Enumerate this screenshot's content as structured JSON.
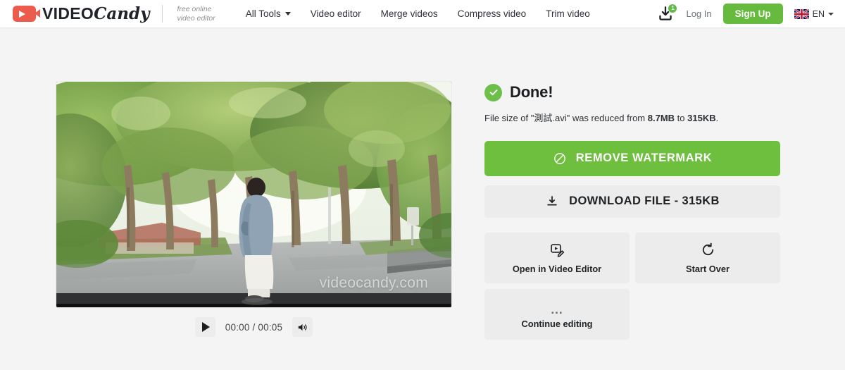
{
  "header": {
    "brand": {
      "word_main": "VIDEO",
      "word_script": "Candy",
      "tagline_line1": "free online",
      "tagline_line2": "video editor",
      "logo_icon": "video-camera-icon",
      "brand_color": "#ec5b4b"
    },
    "nav": [
      {
        "label": "All Tools",
        "has_caret": true
      },
      {
        "label": "Video editor",
        "has_caret": false
      },
      {
        "label": "Merge videos",
        "has_caret": false
      },
      {
        "label": "Compress video",
        "has_caret": false
      },
      {
        "label": "Trim video",
        "has_caret": false
      }
    ],
    "downloads": {
      "icon": "download-tray-icon",
      "badge_count": "1",
      "badge_color": "#62bb46"
    },
    "login_label": "Log In",
    "signup_label": "Sign Up",
    "signup_color": "#66bb3f",
    "language": {
      "flag": "uk-flag-icon",
      "code": "EN",
      "caret": "chevron-down-icon"
    }
  },
  "player": {
    "scene_description": "tree-lined street with person walking",
    "watermark": "videocandy.com",
    "play_icon": "play-icon",
    "time_display": "00:00 / 00:05",
    "current_time": "00:00",
    "duration": "00:05",
    "volume_icon": "volume-on-icon"
  },
  "result": {
    "status_icon": "check-circle-icon",
    "status_color": "#6cc04a",
    "title": "Done!",
    "note_prefix": "File size of \"測試.avi\" was reduced from ",
    "note_size_before": "8.7MB",
    "note_middle": " to ",
    "note_size_after": "315KB",
    "note_suffix": ".",
    "file_name": "測試.avi",
    "remove_watermark": {
      "label": "REMOVE WATERMARK",
      "icon": "no-entry-icon",
      "color": "#6fbf3e"
    },
    "download": {
      "label": "DOWNLOAD FILE - 315KB",
      "icon": "download-icon"
    },
    "tiles": [
      {
        "label": "Open in Video Editor",
        "icon": "video-edit-icon"
      },
      {
        "label": "Start Over",
        "icon": "restart-arrow-icon"
      },
      {
        "label": "Continue editing",
        "icon": "ellipsis-icon",
        "glyph": "..."
      }
    ]
  }
}
